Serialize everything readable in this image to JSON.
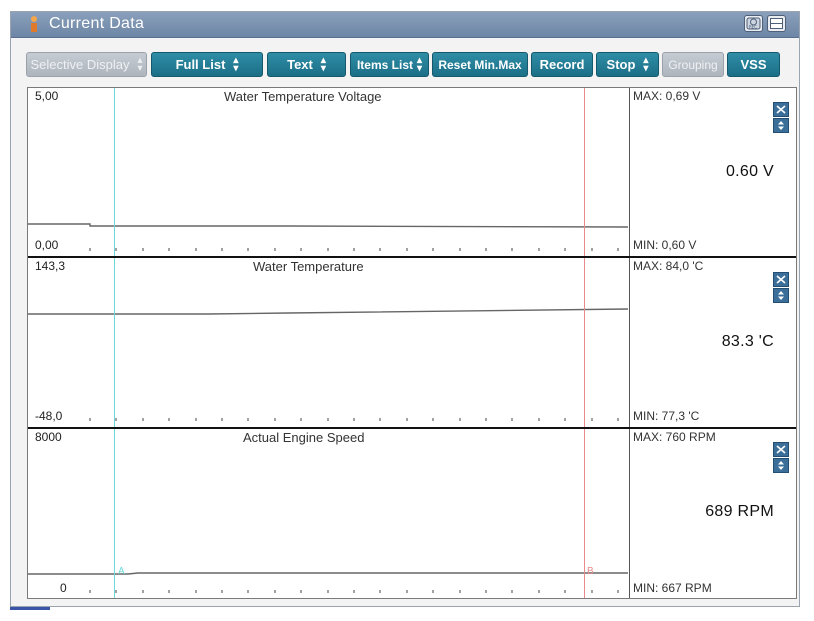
{
  "window": {
    "title": "Current Data"
  },
  "toolbar": {
    "buttons": [
      {
        "label": "Selective Display",
        "dropdown": true,
        "enabled": false
      },
      {
        "label": "Full List",
        "dropdown": true,
        "enabled": true
      },
      {
        "label": "Text",
        "dropdown": true,
        "enabled": true
      },
      {
        "label": "Items List",
        "dropdown": true,
        "enabled": true
      },
      {
        "label": "Reset Min.Max",
        "dropdown": false,
        "enabled": true
      },
      {
        "label": "Record",
        "dropdown": false,
        "enabled": true
      },
      {
        "label": "Stop",
        "dropdown": true,
        "enabled": true
      },
      {
        "label": "Grouping",
        "dropdown": false,
        "enabled": false
      },
      {
        "label": "VSS",
        "dropdown": false,
        "enabled": true
      }
    ]
  },
  "cursors": {
    "a_label": "A",
    "b_label": "B"
  },
  "charts": [
    {
      "title": "Water Temperature Voltage",
      "scale_max": "5,00",
      "scale_min": "0,00",
      "max_text": "MAX:  0,69 V",
      "min_text": "MIN:  0,60 V",
      "current": "0.60 V"
    },
    {
      "title": "Water Temperature",
      "scale_max": "143,3",
      "scale_min": "-48,0",
      "max_text": "MAX:  84,0 'C",
      "min_text": "MIN:  77,3 'C",
      "current": "83.3 'C"
    },
    {
      "title": "Actual Engine Speed",
      "scale_max": "8000",
      "scale_min": "0",
      "max_text": "MAX:    760 RPM",
      "min_text": "MIN:   667 RPM",
      "current": "689 RPM"
    }
  ],
  "colors": {
    "accent": "#1f7690",
    "title_bar": "#7a92b0",
    "cursor_a": "#6fd8d8",
    "cursor_b": "#e88a8a"
  },
  "icons": [
    "window-icon",
    "recording-icon",
    "restore-icon",
    "close-icon",
    "updown-icon"
  ]
}
